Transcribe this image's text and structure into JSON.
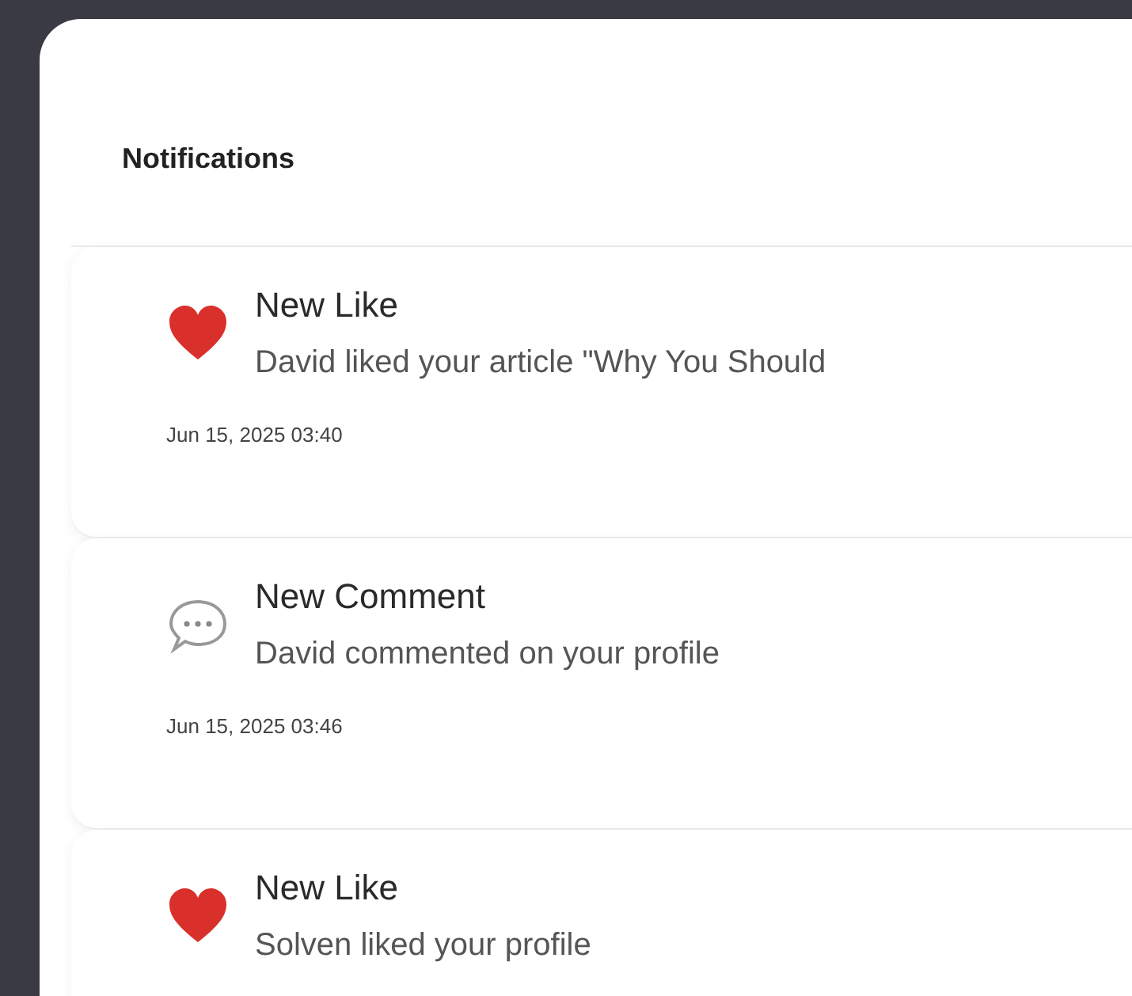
{
  "panel": {
    "title": "Notifications"
  },
  "notifications": [
    {
      "kind": "like",
      "title": "New Like",
      "message": "David liked your article \"Why You Should",
      "time": "Jun 15, 2025 03:40"
    },
    {
      "kind": "comment",
      "title": "New Comment",
      "message": "David commented on your profile",
      "time": "Jun 15, 2025 03:46"
    },
    {
      "kind": "like",
      "title": "New Like",
      "message": "Solven liked your profile"
    }
  ]
}
